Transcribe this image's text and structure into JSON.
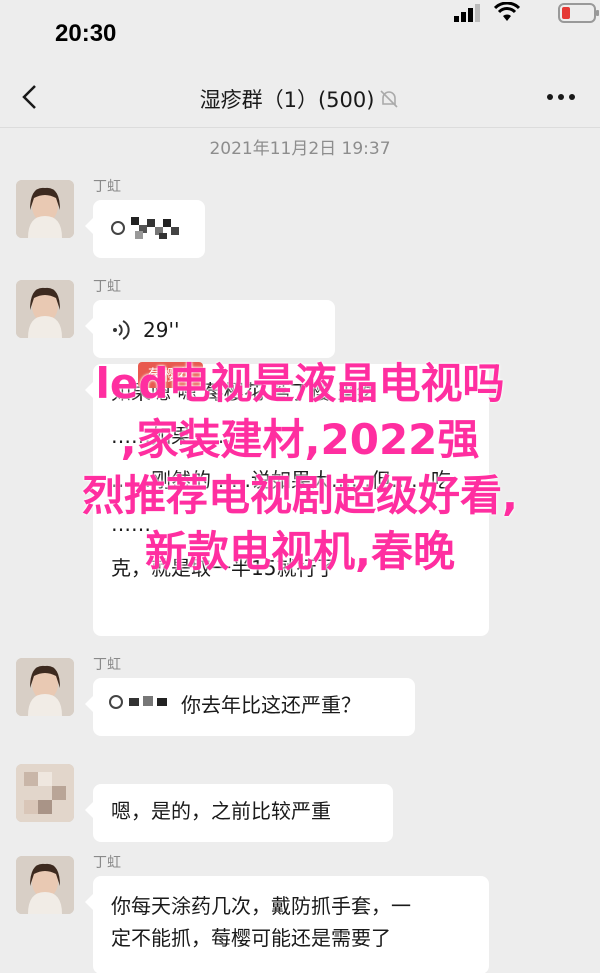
{
  "status": {
    "time": "20:30"
  },
  "nav": {
    "title": "湿疹群（1）(500)"
  },
  "chat": {
    "timestamp": "2021年11月2日 19:37",
    "messages": [
      {
        "sender": "丁虹",
        "text": "",
        "kind": "pixelated"
      },
      {
        "sender": "丁虹",
        "text": "29''",
        "kind": "voice"
      },
      {
        "sender": "",
        "text": "如果嗯    嗯   莓樱花   茑丁樱   当然\n……如果……\n……刚然的……说如果大……但……吃\n……\n克，就是取一半15就行了",
        "tag": "莓樱花"
      },
      {
        "sender": "丁虹",
        "text": "你去年比这还严重？",
        "kind": "pixelated-prefix"
      },
      {
        "sender": "",
        "text": "嗯，是的，之前比较严重"
      },
      {
        "sender": "丁虹",
        "text": "你每天涂药几次，戴防抓手套，一\n定不能抓，莓樱可能还是需要了"
      }
    ]
  },
  "overlay": {
    "lines": [
      "led电视是液晶电视吗",
      ",家装建材,2022强",
      "烈推荐电视剧超级好看,",
      "新款电视机,春晚"
    ]
  },
  "colors": {
    "overlay": "#ff2ea0",
    "background": "#ededed",
    "bubble": "#ffffff"
  }
}
